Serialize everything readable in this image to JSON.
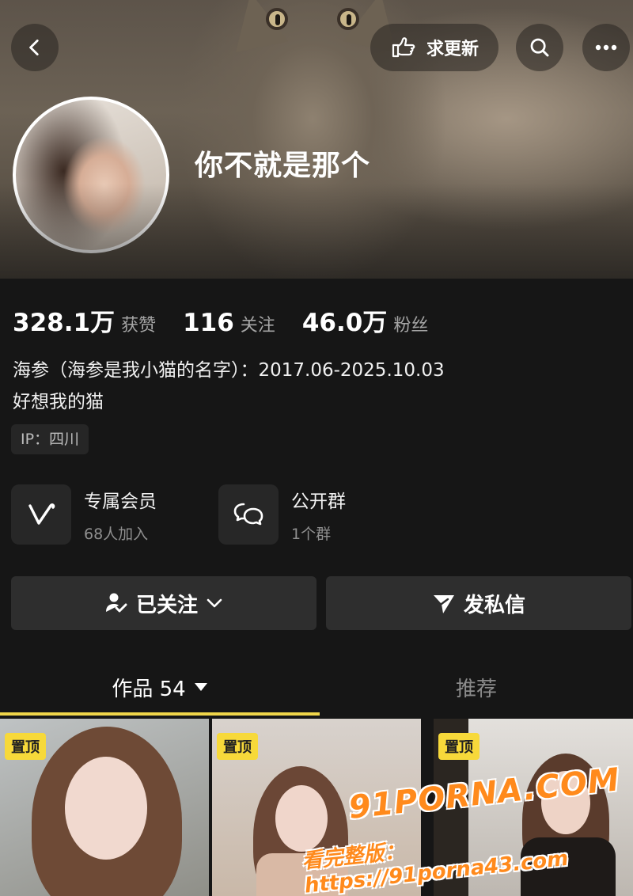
{
  "header": {
    "follow_update_label": "求更新",
    "username": "你不就是那个"
  },
  "stats": [
    {
      "value": "328.1万",
      "label": "获赞"
    },
    {
      "value": "116",
      "label": "关注"
    },
    {
      "value": "46.0万",
      "label": "粉丝"
    }
  ],
  "bio": {
    "line1": "海参（海参是我小猫的名字）：2017.06-2025.10.03",
    "line2": "好想我的猫"
  },
  "ip_tag": "IP：四川",
  "features": [
    {
      "title": "专属会员",
      "subtitle": "68人加入",
      "icon": "v-member-icon"
    },
    {
      "title": "公开群",
      "subtitle": "1个群",
      "icon": "group-chat-icon"
    }
  ],
  "actions": {
    "followed_label": "已关注",
    "message_label": "发私信"
  },
  "tabs": {
    "works_label": "作品 54",
    "recommend_label": "推荐"
  },
  "thumbnails": [
    {
      "badge": "置顶"
    },
    {
      "badge": "置顶"
    },
    {
      "badge": "置顶"
    }
  ],
  "watermark": {
    "logo": "91PORNA.COM",
    "url": "看完整版：https://91porna43.com"
  },
  "colors": {
    "background": "#161616",
    "card": "#2e2e2e",
    "accent_underline": "#f0d64a",
    "pin_badge": "#f7d93a",
    "watermark": "#ff8a1c"
  }
}
